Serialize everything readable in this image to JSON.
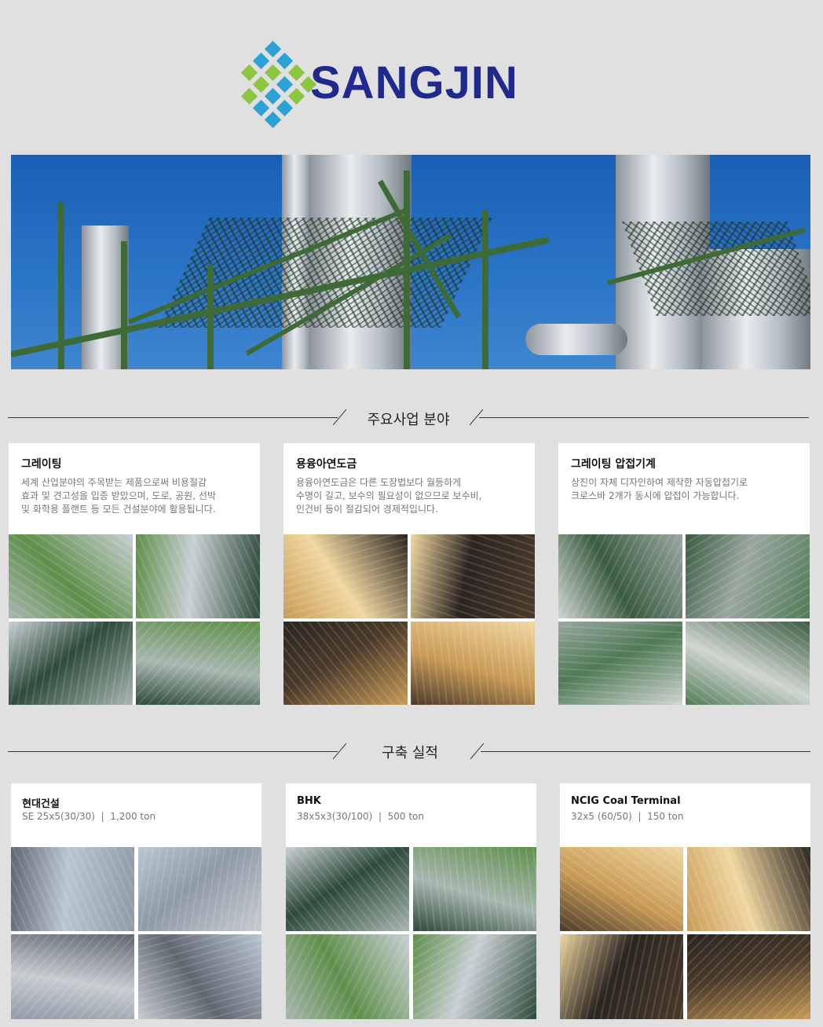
{
  "brand": {
    "name": "SANGJIN"
  },
  "sections": {
    "business": {
      "title": "주요사업 분야"
    },
    "projects": {
      "title": "구축 실적"
    }
  },
  "business_cards": [
    {
      "title": "그레이팅",
      "desc": "세계 산업분야의 주목받는 제품으로써 비용절감\n효과 및 견고성을 입증 받았으며, 도로, 공원, 선박\n및 화학용 플랜트 등 모든 건설분야에 활용됩니다."
    },
    {
      "title": "용융아연도금",
      "desc": "용융아연도금은 다른 도장법보다 월등하게\n수명이 길고, 보수의 필요성이 없으므로 보수비,\n인건비 등이 절감되어 경제적입니다."
    },
    {
      "title": "그레이팅 압접기계",
      "desc": "상진이 자체 디자인하여 제작한 자동압접기로\n크로스바 2개가 동시에 압접이 가능합니다."
    }
  ],
  "project_cards": [
    {
      "title": "현대건설",
      "spec": "SE 25x5(30/30)  |  1,200 ton"
    },
    {
      "title": "BHK",
      "spec": "38x5x3(30/100)  |  500 ton"
    },
    {
      "title": "NCIG Coal Terminal",
      "spec": "32x5 (60/50)  |  150 ton"
    }
  ],
  "colors": {
    "brand_blue": "#1f2a8c",
    "logo_green": "#8cc63f",
    "logo_blue": "#29a3d6",
    "background": "#e0e0e0"
  },
  "icons": {
    "logo_mark": "diamond-grid-logo-icon"
  }
}
